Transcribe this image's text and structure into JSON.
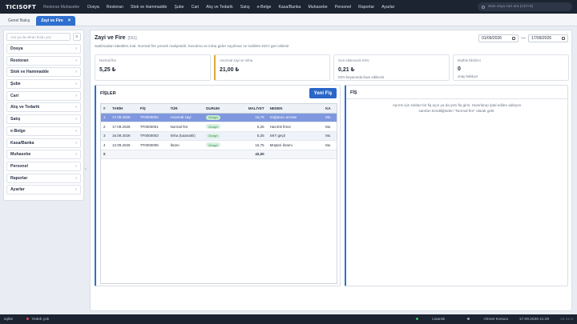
{
  "app": {
    "logo": "TICISOFT",
    "subtitle": "Restoran Muhasebe"
  },
  "menu": [
    "Dosya",
    "Restoran",
    "Stok ve Hammadde",
    "Şube",
    "Cari",
    "Alış ve Tedarik",
    "Satış",
    "e-Belge",
    "Kasa/Banka",
    "Muhasebe",
    "Personel",
    "Raporlar",
    "Ayarlar"
  ],
  "search": {
    "placeholder": "Stok veya cari ara (Ctrl+K)"
  },
  "tabs": [
    {
      "label": "Genel Bakış"
    },
    {
      "label": "Zayi ve Fire"
    }
  ],
  "sidebar": {
    "search_placeholder": "Ara ya da ekran kodu yaz",
    "button": "≡",
    "items": [
      "Dosya",
      "Restoran",
      "Stok ve Hammadde",
      "Şube",
      "Cari",
      "Alış ve Tedarik",
      "Satış",
      "e-Belge",
      "Kasa/Banka",
      "Muhasebe",
      "Personel",
      "Raporlar",
      "Ayarlar"
    ]
  },
  "page": {
    "title": "Zayi ve Fire",
    "code": "[551]",
    "description": "Satılmadan tüketilen mal. Normal fire yemek maliyetidir; bozulma ve imha gider sayılmaz ve indirilen KDV geri eklenir.",
    "date_from": "01/09/2026",
    "date_to": "17/09/2026",
    "date_sep": "—"
  },
  "cards": [
    {
      "label": "Normal fire",
      "value": "5,25 ₺",
      "sub": ""
    },
    {
      "label": "Anormal zayi ve imha",
      "value": "21,00 ₺",
      "sub": ""
    },
    {
      "label": "Geri eklenecek KDV",
      "value": "0,21 ₺",
      "sub": "KDV beyanında ilave edilecek"
    },
    {
      "label": "Mutfak bildirimi",
      "value": "0",
      "sub": "onay bekliyor"
    }
  ],
  "list": {
    "title": "FİŞLER",
    "new_button": "Yeni Fiş",
    "columns": [
      "#",
      "TARİH",
      "FİŞ",
      "TÜR",
      "DURUM",
      "MALİYET",
      "NEDEN",
      "KA"
    ],
    "rows": [
      {
        "n": "1",
        "date": "17.09.2026",
        "doc": "TF0000002",
        "type": "Anormal zayi",
        "status": "Onaylı",
        "cost": "15,75",
        "reason": "Soğutucu arızası",
        "ka": "Mu"
      },
      {
        "n": "2",
        "date": "17.09.2026",
        "doc": "TF0000001",
        "type": "Normal fire",
        "status": "Onaylı",
        "cost": "5,25",
        "reason": "Hazırlık firesi",
        "ka": "Mu"
      },
      {
        "n": "3",
        "date": "16.09.2026",
        "doc": "TF0000003",
        "type": "İmha (tutanaklı)",
        "status": "Onaylı",
        "cost": "5,25",
        "reason": "SKT geçti",
        "ka": "Mu"
      },
      {
        "n": "4",
        "date": "12.09.2026",
        "doc": "TF0000005",
        "type": "İkram",
        "status": "Onaylı",
        "cost": "15,75",
        "reason": "Müşteri ikramı",
        "ka": "Mu"
      }
    ],
    "sum_label": "Σ",
    "sum_value": "42,00"
  },
  "detail": {
    "title": "FİŞ",
    "message": "Ayrıntı için soldan bir fiş açın ya da yeni fiş girin. Hazırlanıp iptal edilen adisyon satırları kendiliğinden \"Normal fire\" olarak gelir."
  },
  "status": {
    "user_db": "sqlite",
    "backup": "Yedek yok",
    "license": "Lisanslı",
    "person": "Ahmet Koraca",
    "datetime": "17.09.2026 21:30",
    "version": "v2.12.3"
  },
  "colors": {
    "accent": "#2f6fd0",
    "topbar": "#1c2432",
    "selected_row": "#7f97de",
    "status_ok": "#2e8a4c",
    "warn_border": "#e0a63a"
  }
}
